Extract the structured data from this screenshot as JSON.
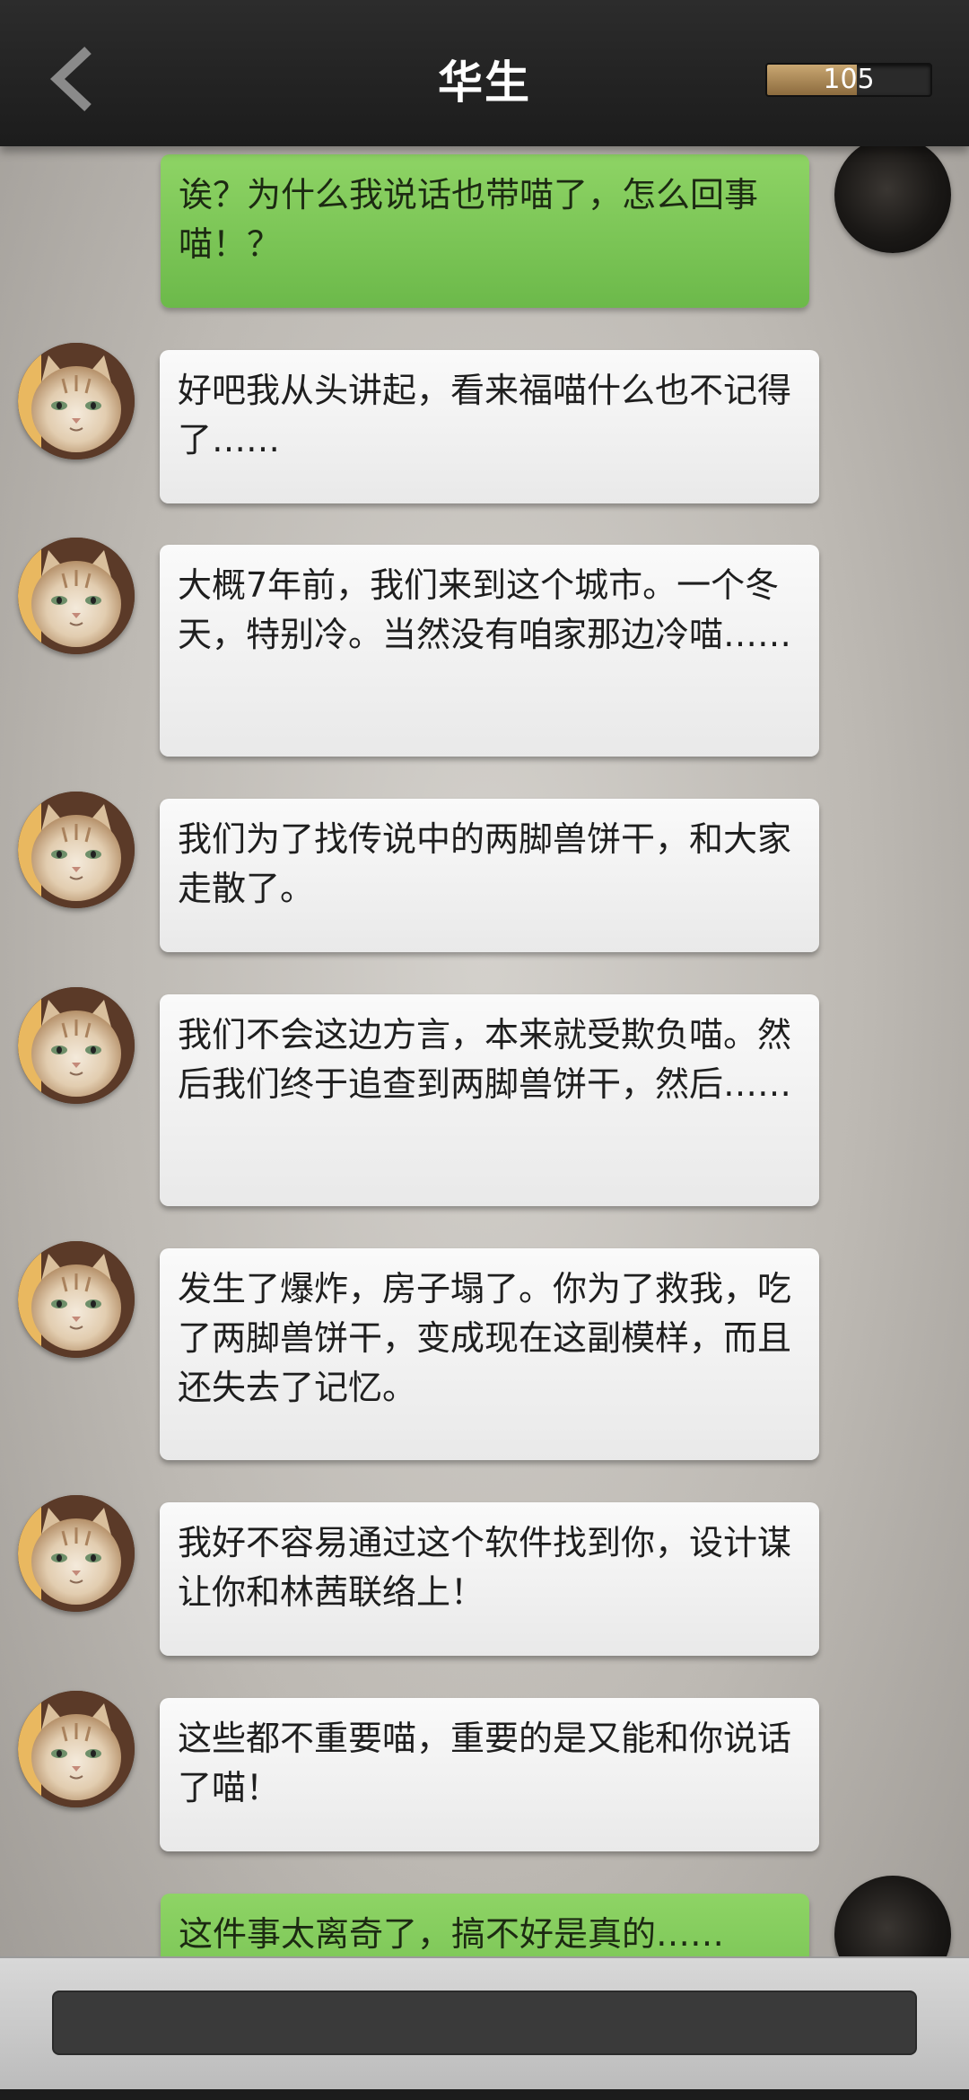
{
  "header": {
    "title": "华生",
    "coins": "105",
    "coin_fill_fraction": 0.55
  },
  "messages": [
    {
      "from": "me",
      "text": "诶？为什么我说话也带喵了，怎么回事喵！？"
    },
    {
      "from": "cat",
      "text": "好吧我从头讲起，看来福喵什么也不记得了……"
    },
    {
      "from": "cat",
      "text": "大概7年前，我们来到这个城市。一个冬天，特别冷。当然没有咱家那边冷喵……"
    },
    {
      "from": "cat",
      "text": "我们为了找传说中的两脚兽饼干，和大家走散了。"
    },
    {
      "from": "cat",
      "text": "我们不会这边方言，本来就受欺负喵。然后我们终于追查到两脚兽饼干，然后……"
    },
    {
      "from": "cat",
      "text": "发生了爆炸，房子塌了。你为了救我，吃了两脚兽饼干，变成现在这副模样，而且还失去了记忆。"
    },
    {
      "from": "cat",
      "text": "我好不容易通过这个软件找到你，设计谋让你和林茜联络上！"
    },
    {
      "from": "cat",
      "text": "这些都不重要喵，重要的是又能和你说话了喵！"
    },
    {
      "from": "me",
      "text": "这件事太离奇了，搞不好是真的……"
    }
  ],
  "input": {
    "placeholder": ""
  },
  "icons": {
    "back": "chevron-left-icon",
    "cat_avatar": "cat-avatar",
    "player_avatar": "player-avatar"
  },
  "colors": {
    "header": "#1f1f1f",
    "bubble_in": "#f2f2f2",
    "bubble_out": "#7cc655",
    "coin_fill": "#a9875a"
  }
}
